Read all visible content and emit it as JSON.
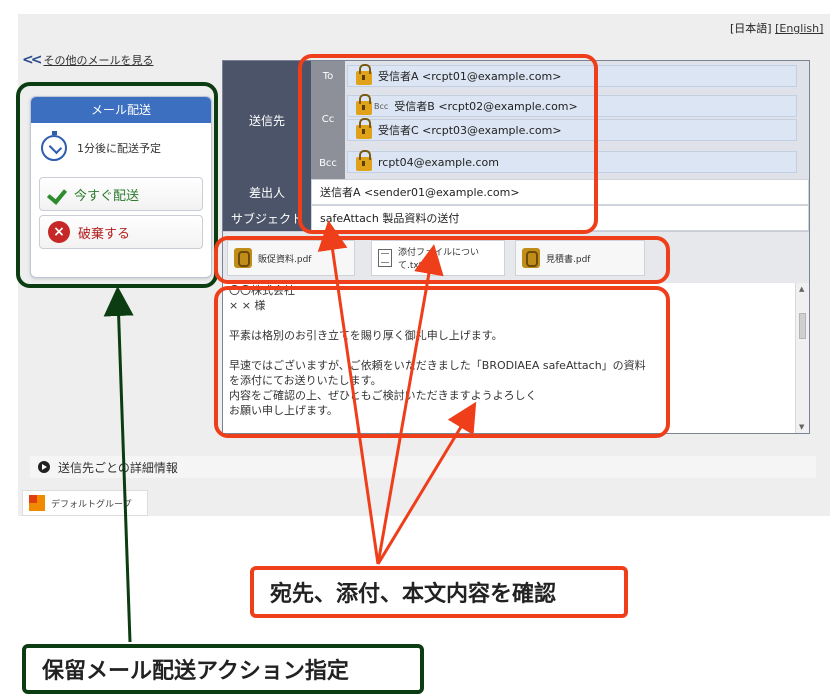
{
  "lang": {
    "ja": "[日本語]",
    "en": "[English]"
  },
  "back_link": "その他のメールを見る",
  "action_panel": {
    "title": "メール配送",
    "schedule": "1分後に配送予定",
    "send_now": "今すぐ配送",
    "discard": "破棄する"
  },
  "mail": {
    "labels": {
      "to_group": "送信先",
      "from": "差出人",
      "subject": "サブジェクト"
    },
    "kinds": {
      "to": "To",
      "cc": "Cc",
      "bcc": "Bcc"
    },
    "recipients": {
      "to": [
        "受信者A <rcpt01@example.com>"
      ],
      "cc": [
        "受信者B <rcpt02@example.com>",
        "受信者C <rcpt03@example.com>"
      ],
      "bcc": [
        "rcpt04@example.com"
      ]
    },
    "bcc_badge": "Bcc",
    "from": "送信者A <sender01@example.com>",
    "subject": "safeAttach 製品資料の送付",
    "attachments": [
      "販促資料.pdf",
      "添付ファイルについて.txt",
      "見積書.pdf"
    ],
    "body": "〇〇株式会社\n× × 様\n\n平素は格別のお引き立てを賜り厚く御礼申し上げます。\n\n早速ではございますが、ご依頼をいただきました「BRODIAEA safeAttach」の資料\nを添付にてお送りいたします。\n内容をご確認の上、ぜひともご検討いただきますようよろしく\nお願い申し上げます。"
  },
  "details_toggle": "送信先ごとの詳細情報",
  "group_name": "デフォルトグループ",
  "callouts": {
    "check": "宛先、添付、本文内容を確認",
    "action": "保留メール配送アクション指定"
  },
  "colors": {
    "annotation_red": "#ef3e1a",
    "annotation_green": "#0c3d12",
    "panel_header": "#3d6fc1"
  }
}
